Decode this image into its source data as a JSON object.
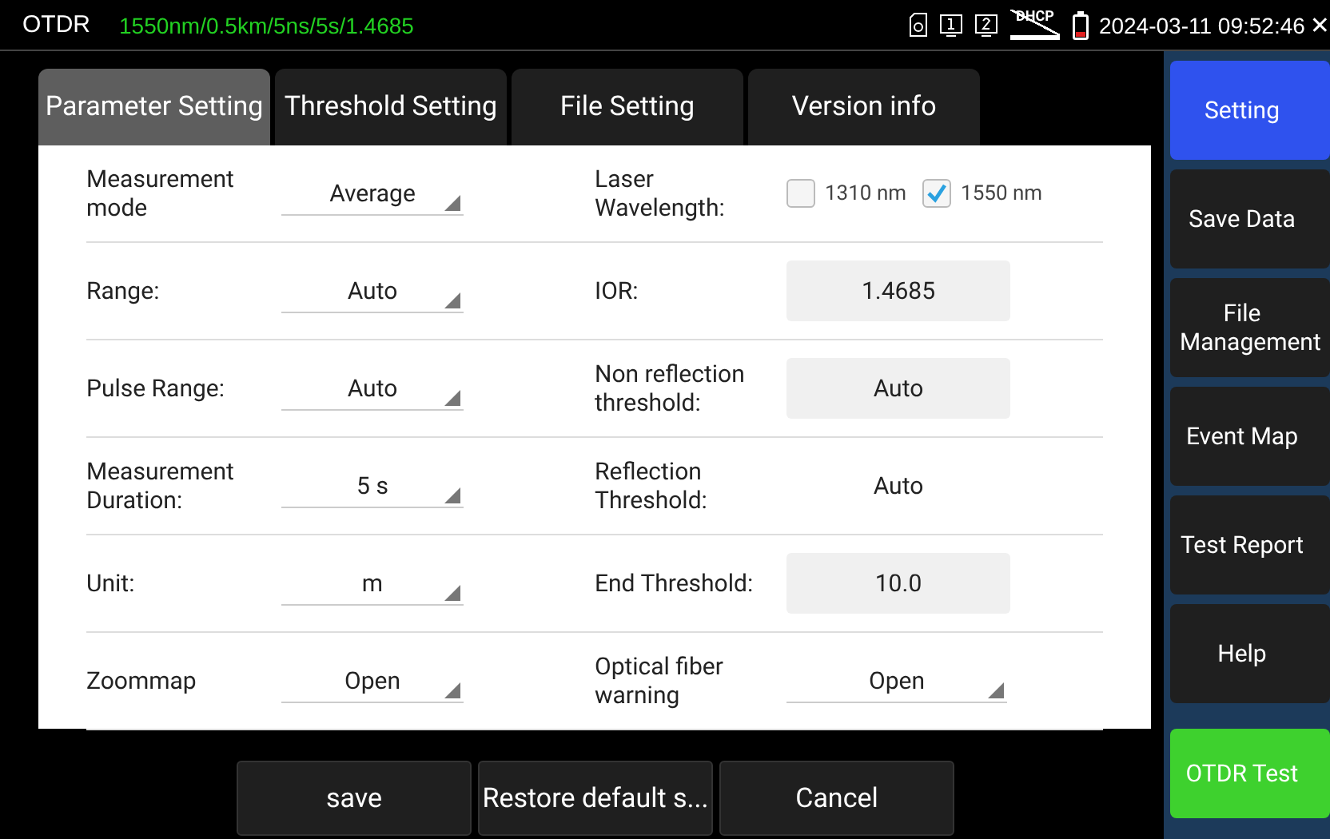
{
  "status_bar": {
    "app": "OTDR",
    "summary": "1550nm/0.5km/5ns/5s/1.4685",
    "dhcp_label": "DHCP",
    "datetime": "2024-03-11 09:52:46",
    "close": "✕"
  },
  "tabs": [
    {
      "label": "Parameter Setting",
      "selected": true
    },
    {
      "label": "Threshold Setting",
      "selected": false
    },
    {
      "label": "File Setting",
      "selected": false
    },
    {
      "label": "Version info",
      "selected": false
    }
  ],
  "rows": [
    {
      "label": "Measurement mode",
      "value": "Average",
      "right": {
        "kind": "checkboxes",
        "label": "Laser Wavelength:",
        "options": [
          {
            "label": "1310 nm",
            "checked": false
          },
          {
            "label": "1550 nm",
            "checked": true
          }
        ]
      }
    },
    {
      "label": "Range:",
      "value": "Auto",
      "right": {
        "kind": "field",
        "label": "IOR:",
        "value": "1.4685"
      }
    },
    {
      "label": "Pulse Range:",
      "value": "Auto",
      "right": {
        "kind": "field",
        "label": "Non reflection threshold:",
        "value": "Auto"
      }
    },
    {
      "label": "Measurement Duration:",
      "value": "5 s",
      "right": {
        "kind": "text",
        "label": "Reflection Threshold:",
        "value": "Auto"
      }
    },
    {
      "label": "Unit:",
      "value": "m",
      "right": {
        "kind": "field",
        "label": "End Threshold:",
        "value": "10.0"
      }
    },
    {
      "label": "Zoommap",
      "value": "Open",
      "right": {
        "kind": "dropdown",
        "label": "Optical fiber warning",
        "value": "Open"
      }
    }
  ],
  "buttons": [
    "save",
    "Restore default s...",
    "Cancel"
  ],
  "sidebar": [
    {
      "label": "Setting",
      "selected": true,
      "kind": "normal"
    },
    {
      "label": "Save Data",
      "selected": false,
      "kind": "normal"
    },
    {
      "label": "File Management",
      "selected": false,
      "kind": "normal"
    },
    {
      "label": "Event Map",
      "selected": false,
      "kind": "normal"
    },
    {
      "label": "Test Report",
      "selected": false,
      "kind": "normal"
    },
    {
      "label": "Help",
      "selected": false,
      "kind": "normal"
    },
    {
      "label": "OTDR Test",
      "selected": false,
      "kind": "action"
    }
  ]
}
